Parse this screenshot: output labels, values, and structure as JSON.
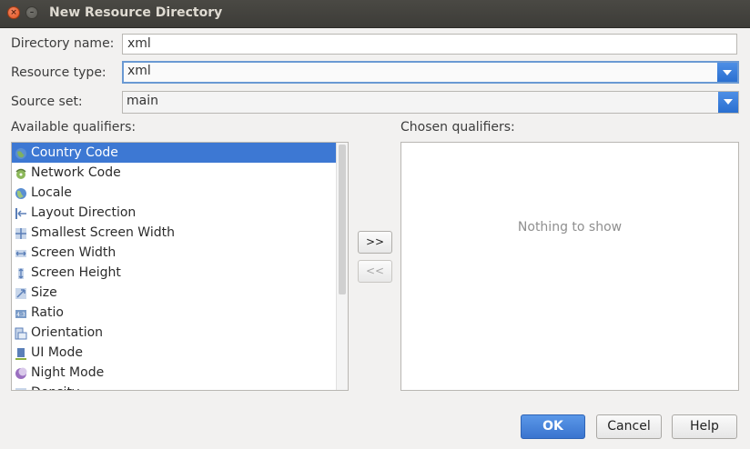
{
  "window": {
    "title": "New Resource Directory"
  },
  "form": {
    "directory_name": {
      "label": "Directory name:",
      "value": "xml"
    },
    "resource_type": {
      "label": "Resource type:",
      "value": "xml"
    },
    "source_set": {
      "label": "Source set:",
      "value": "main"
    }
  },
  "available": {
    "label": "Available qualifiers:",
    "items": [
      {
        "label": "Country Code",
        "icon": "country-code-icon",
        "selected": true
      },
      {
        "label": "Network Code",
        "icon": "network-code-icon"
      },
      {
        "label": "Locale",
        "icon": "globe-icon"
      },
      {
        "label": "Layout Direction",
        "icon": "layout-direction-icon"
      },
      {
        "label": "Smallest Screen Width",
        "icon": "smallest-width-icon"
      },
      {
        "label": "Screen Width",
        "icon": "screen-width-icon"
      },
      {
        "label": "Screen Height",
        "icon": "screen-height-icon"
      },
      {
        "label": "Size",
        "icon": "size-icon"
      },
      {
        "label": "Ratio",
        "icon": "ratio-icon"
      },
      {
        "label": "Orientation",
        "icon": "orientation-icon"
      },
      {
        "label": "UI Mode",
        "icon": "ui-mode-icon"
      },
      {
        "label": "Night Mode",
        "icon": "night-mode-icon"
      },
      {
        "label": "Density",
        "icon": "density-icon"
      }
    ]
  },
  "chosen": {
    "label": "Chosen qualifiers:",
    "empty_text": "Nothing to show"
  },
  "move": {
    "add": ">>",
    "remove": "<<"
  },
  "buttons": {
    "ok": "OK",
    "cancel": "Cancel",
    "help": "Help"
  },
  "colors": {
    "accent": "#3d78d3",
    "title_bg": "#3d3c38",
    "dialog_bg": "#f2f1f0"
  }
}
